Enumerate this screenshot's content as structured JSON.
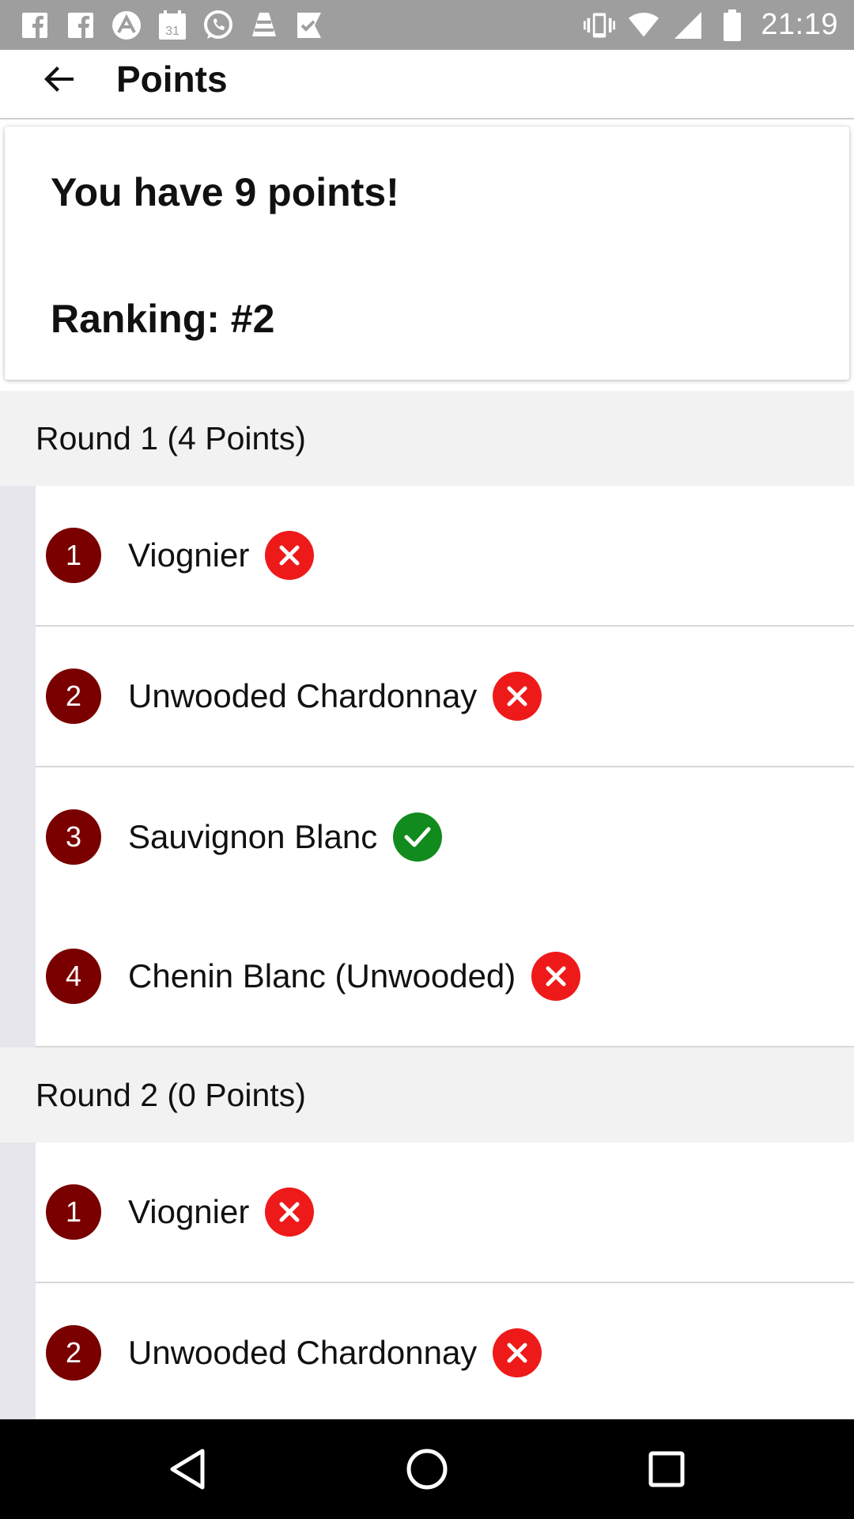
{
  "status_bar": {
    "time": "21:19",
    "calendar_day": "31",
    "left_icons": [
      "facebook-icon",
      "facebook-icon",
      "arch-icon",
      "calendar-icon",
      "whatsapp-icon",
      "vlc-icon",
      "check-flag-icon"
    ],
    "right_icons": [
      "vibrate-icon",
      "wifi-icon",
      "signal-icon",
      "battery-icon"
    ]
  },
  "app_bar": {
    "title": "Points"
  },
  "summary": {
    "points_text": "You have 9 points!",
    "ranking_text": "Ranking: #2"
  },
  "rounds": [
    {
      "header": "Round 1 (4 Points)",
      "items": [
        {
          "number": "1",
          "label": "Viognier",
          "result": "wrong"
        },
        {
          "number": "2",
          "label": "Unwooded Chardonnay",
          "result": "wrong"
        },
        {
          "number": "3",
          "label": "Sauvignon Blanc",
          "result": "correct"
        },
        {
          "number": "4",
          "label": "Chenin Blanc (Unwooded)",
          "result": "wrong"
        }
      ]
    },
    {
      "header": "Round 2 (0 Points)",
      "items": [
        {
          "number": "1",
          "label": "Viognier",
          "result": "wrong"
        },
        {
          "number": "2",
          "label": "Unwooded Chardonnay",
          "result": "wrong"
        }
      ]
    }
  ],
  "colors": {
    "number_badge": "#7a0000",
    "wrong": "#ee1a1a",
    "correct": "#118a1e",
    "status_bar": "#9e9e9e"
  }
}
